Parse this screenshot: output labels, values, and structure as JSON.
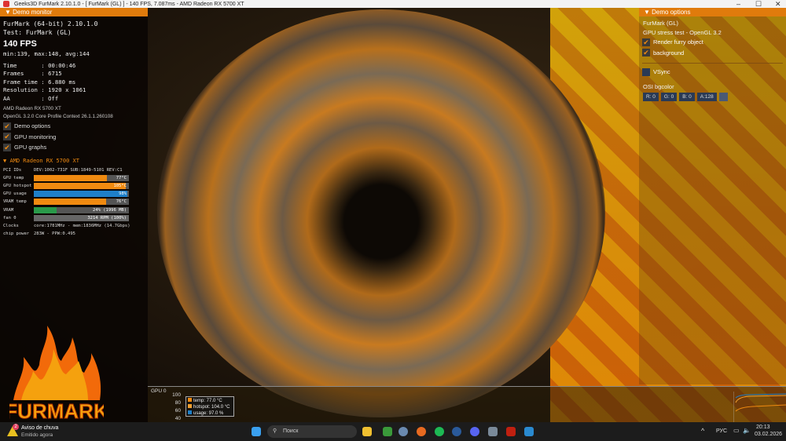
{
  "window": {
    "title": "Geeks3D FurMark 2.10.1.0 - [ FurMark (GL) ] - 140 FPS, 7.087ms - AMD Radeon RX 5700 XT",
    "minimize": "–",
    "maximize": "☐",
    "close": "✕"
  },
  "demo_monitor": {
    "header": "Demo monitor",
    "app": "FurMark (64-bit) 2.10.1.0",
    "test": "Test: FurMark (GL)",
    "fps": "140 FPS",
    "fps_stats": "min:139, max:148, avg:144",
    "stats": [
      "Time       : 00:00:46",
      "Frames     : 6715",
      "Frame time : 6.880 ms",
      "Resolution : 1920 x 1061",
      "AA         : Off"
    ],
    "gpu_name": "AMD Radeon RX 5700 XT",
    "gl_info": "OpenGL 3.2.0 Core Profile Context 26.1.1.260108",
    "checkboxes": [
      {
        "label": "Demo options",
        "checked": true
      },
      {
        "label": "GPU monitoring",
        "checked": true
      },
      {
        "label": "GPU graphs",
        "checked": true
      }
    ]
  },
  "gpu_monitor": {
    "header": "AMD Radeon RX 5700 XT",
    "pci_label": "PCI IDs",
    "pci": "DEV:1002-731F SUB:1849-5101 REV:C1",
    "bars": [
      {
        "label": "GPU temp",
        "value": "77°C",
        "percent": 77,
        "color": "#f08a10"
      },
      {
        "label": "GPU hotspot",
        "value": "105°C",
        "percent": 97,
        "color": "#f08a10"
      },
      {
        "label": "GPU usage",
        "value": "98%",
        "percent": 98,
        "color": "#1e7fc8"
      },
      {
        "label": "VRAM temp",
        "value": "76°C",
        "percent": 76,
        "color": "#f08a10"
      },
      {
        "label": "VRAM",
        "value": "24% (1996 MB)",
        "percent": 24,
        "color": "#2a9a4a"
      },
      {
        "label": "fan 0",
        "value": "3214 RPM (100%)",
        "percent": 100,
        "color": "#666"
      }
    ],
    "clocks_label": "Clocks",
    "clocks": "core:1781MHz - mem:1836MHz (14.7Gbps)",
    "power_label": "chip power",
    "power": "283W - PPW:0.495"
  },
  "demo_options": {
    "header": "Demo options",
    "name": "FurMark (GL)",
    "desc": "GPU stress test - OpenGL 3.2",
    "checkboxes": [
      {
        "label": "Render furry object",
        "checked": true
      },
      {
        "label": "background",
        "checked": true
      },
      {
        "label": "VSync",
        "checked": false
      }
    ],
    "osi_label": "OSI bgcolor",
    "osi": [
      "R: 0",
      "G: 0",
      "B: 0",
      "A:128"
    ]
  },
  "graph": {
    "title": "GPU 0",
    "ticks": [
      "100",
      "80",
      "60",
      "40"
    ],
    "legend": [
      {
        "label": "temp: 77.0 °C",
        "color": "#f08a10"
      },
      {
        "label": "hotspot: 104.0 °C",
        "color": "#f0a030"
      },
      {
        "label": "usage: 97.0 %",
        "color": "#1e7fc8"
      }
    ]
  },
  "logo": {
    "text": "FURMARK"
  },
  "taskbar": {
    "notification_title": "Aviso de chuva",
    "notification_sub": "Emitido agora",
    "notification_badge": "2",
    "search": "Поиск",
    "lang": "РУС",
    "time": "20:13",
    "date": "03.02.2026",
    "tray_chevron": "^"
  }
}
